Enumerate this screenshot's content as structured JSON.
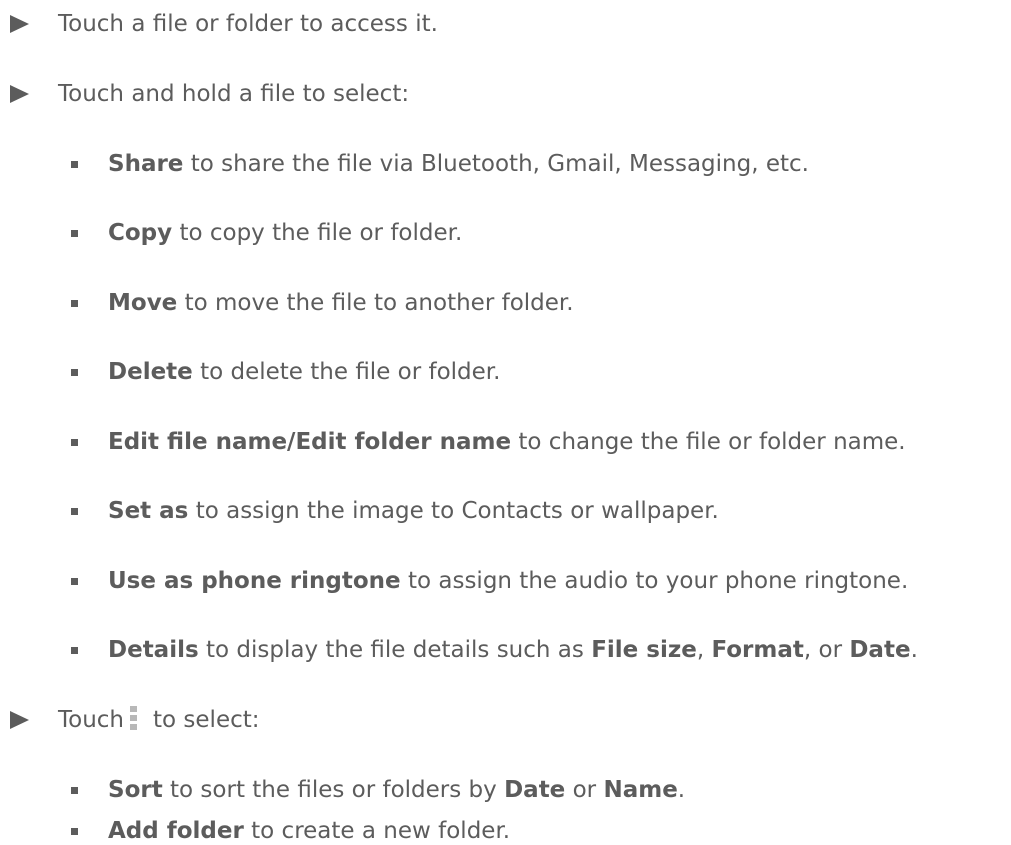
{
  "items": [
    {
      "bold": "",
      "text": "Touch a file or folder to access it."
    },
    {
      "bold": "",
      "text": "Touch and hold a file to select:"
    },
    {
      "bold": "Share",
      "text": " to share the file via Bluetooth, Gmail, Messaging, etc."
    },
    {
      "bold": "Copy",
      "text": " to copy the file or folder."
    },
    {
      "bold": "Move",
      "text": " to move the file to another folder."
    },
    {
      "bold": "Delete",
      "text": " to delete the file or folder."
    },
    {
      "bold": "Edit file name/Edit folder name",
      "text": " to change the file or folder name."
    },
    {
      "bold": "Set as",
      "text": " to assign the image to Contacts or wallpaper."
    },
    {
      "bold": "Use as phone ringtone",
      "text": " to assign the audio to your phone ringtone."
    },
    {
      "bold": "Details",
      "text": " to display the file details such as ",
      "b2": "File size",
      "t2": ", ",
      "b3": "Format",
      "t3": ", or ",
      "b4": "Date",
      "t4": "."
    },
    {
      "text": "Touch",
      "after": "to select:",
      "icon": "more-options-icon"
    },
    {
      "bold": "Sort",
      "text": " to sort the files or folders by ",
      "b2": "Date",
      "t2": " or ",
      "b3": "Name",
      "t3": "."
    },
    {
      "bold": "Add folder",
      "text": " to create a new folder."
    }
  ]
}
